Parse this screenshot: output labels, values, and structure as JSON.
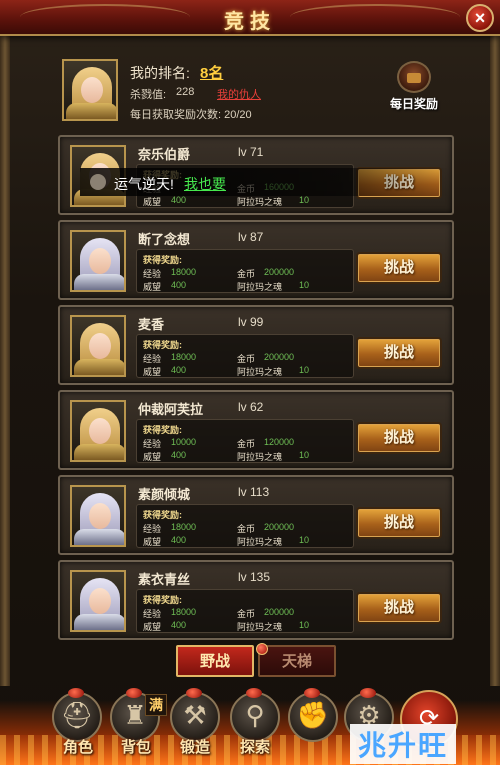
{
  "header": {
    "title": "竞技",
    "close_icon": "×"
  },
  "my_info": {
    "rank_label": "我的排名:",
    "rank_value": "8名",
    "kill_label": "杀戮值:",
    "kill_value": "228",
    "enemy_link": "我的仇人",
    "daily_reward_count": "每日获取奖励次数: 20/20"
  },
  "daily_reward": {
    "label": "每日奖励",
    "icon": "treasure-chest-icon"
  },
  "chat": {
    "text": "运气逆天!",
    "link": "我也要"
  },
  "reward_title": "获得奖励:",
  "reward_labels": {
    "exp": "经验",
    "gold": "金币",
    "prestige": "威望",
    "soul": "阿拉玛之魂"
  },
  "challenge_label": "挑战",
  "opponents": [
    {
      "name": "奈乐伯爵",
      "level": "lv 71",
      "exp": "",
      "gold": "160000",
      "prestige": "400",
      "soul": "10",
      "portrait": "gold"
    },
    {
      "name": "断了念想",
      "level": "lv 87",
      "exp": "18000",
      "gold": "200000",
      "prestige": "400",
      "soul": "10",
      "portrait": "silver"
    },
    {
      "name": "麦香",
      "level": "lv 99",
      "exp": "18000",
      "gold": "200000",
      "prestige": "400",
      "soul": "10",
      "portrait": "gold"
    },
    {
      "name": "仲裁阿芙拉",
      "level": "lv 62",
      "exp": "10000",
      "gold": "120000",
      "prestige": "400",
      "soul": "10",
      "portrait": "gold"
    },
    {
      "name": "素颜倾城",
      "level": "lv 113",
      "exp": "18000",
      "gold": "200000",
      "prestige": "400",
      "soul": "10",
      "portrait": "silver"
    },
    {
      "name": "素衣青丝",
      "level": "lv 135",
      "exp": "18000",
      "gold": "200000",
      "prestige": "400",
      "soul": "10",
      "portrait": "silver"
    }
  ],
  "tabs": {
    "wild": "野战",
    "ladder": "天梯"
  },
  "bottom_nav": [
    {
      "label": "角色",
      "icon": "helmet-icon"
    },
    {
      "label": "背包",
      "icon": "bag-icon"
    },
    {
      "label": "锻造",
      "icon": "anvil-icon"
    },
    {
      "label": "探索",
      "icon": "magnifier-icon"
    },
    {
      "label": "",
      "icon": "gauntlet-icon"
    },
    {
      "label": "",
      "icon": "settings-icon"
    }
  ],
  "full_badge": "满",
  "watermark": "兆升旺"
}
